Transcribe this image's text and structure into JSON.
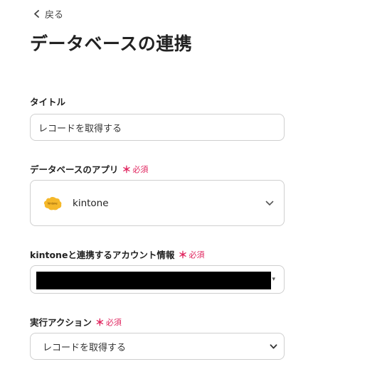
{
  "nav": {
    "back_label": "戻る"
  },
  "page": {
    "title": "データベースの連携"
  },
  "fields": {
    "title": {
      "label": "タイトル",
      "value": "レコードを取得する"
    },
    "app": {
      "label": "データベースのアプリ",
      "required_label": "必須",
      "value": "kintone",
      "logo_text": "kintone"
    },
    "account": {
      "label": "kintoneと連携するアカウント情報",
      "required_label": "必須"
    },
    "action": {
      "label": "実行アクション",
      "required_label": "必須",
      "value": "レコードを取得する"
    }
  },
  "required_mark": "＊",
  "colors": {
    "required": "#e0245e",
    "border": "#cfcfcf",
    "kintone_yellow": "#f5b82a"
  }
}
